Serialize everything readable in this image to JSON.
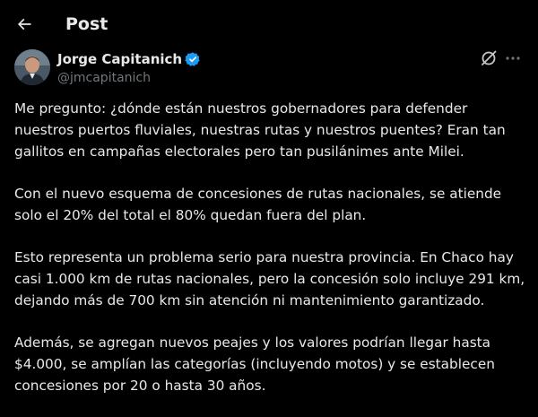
{
  "header": {
    "title": "Post"
  },
  "author": {
    "name": "Jorge Capitanich",
    "handle": "@jmcapitanich",
    "verified_color": "#1d9bf0"
  },
  "post": {
    "paragraphs": [
      "Me pregunto: ¿dónde están nuestros gobernadores para defender\nnuestros puertos fluviales, nuestras rutas y nuestros puentes? Eran tan\ngallitos en campañas electorales pero tan pusilánimes ante Milei.",
      "Con el nuevo esquema de concesiones de rutas nacionales, se atiende\nsolo el 20% del total el 80% quedan fuera del plan.",
      "Esto representa un problema serio para nuestra provincia. En Chaco hay\ncasi 1.000 km de rutas nacionales, pero la concesión solo incluye 291 km,\ndejando más de 700 km sin atención ni mantenimiento garantizado.",
      "Además, se agregan nuevos peajes y los valores podrían llegar hasta\n$4.000, se amplían las categorías (incluyendo motos) y se establecen\nconcesiones por 20 o hasta 30 años."
    ]
  },
  "icons": {
    "back": "arrow-left-icon",
    "grok": "grok-icon",
    "more": "more-icon",
    "verified": "verified-badge-icon"
  },
  "colors": {
    "background": "#000000",
    "text": "#e7e9ea",
    "secondary": "#71767b",
    "accent": "#1d9bf0"
  }
}
